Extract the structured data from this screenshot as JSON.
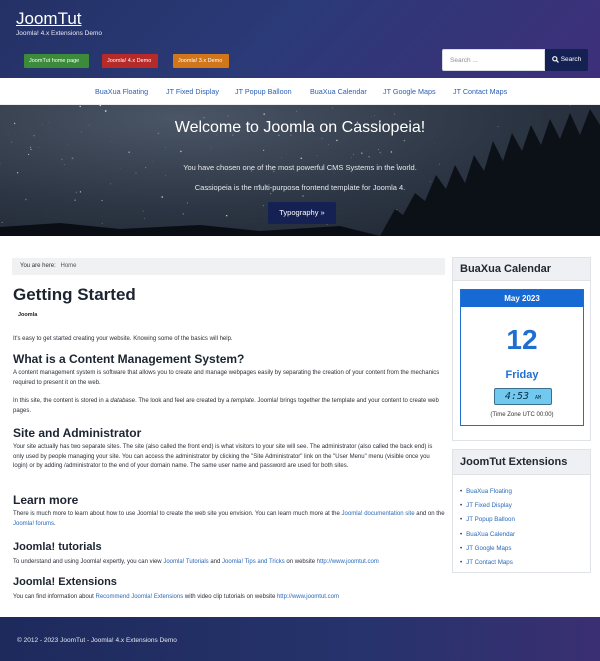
{
  "header": {
    "brand_title": "JoomTut",
    "brand_desc": "Joomla! 4.x Extensions Demo",
    "buttons": [
      "JoomTut home page",
      "Joomla! 4.x Demo",
      "Joomla! 3.x Demo"
    ],
    "search_placeholder": "Search ...",
    "search_button": "Search"
  },
  "nav": {
    "items": [
      "BuaXua Floating",
      "JT Fixed Display",
      "JT Popup Balloon",
      "BuaXua Calendar",
      "JT Google Maps",
      "JT Contact Maps"
    ]
  },
  "banner": {
    "title": "Welcome to Joomla on Cassiopeia!",
    "line1": "You have chosen one of the most powerful CMS Systems in the world.",
    "line2": "Cassiopeia is the multi-purpose frontend template for Joomla 4.",
    "button": "Typography »"
  },
  "breadcrumb": {
    "label": "You are here:",
    "current": "Home"
  },
  "article": {
    "title": "Getting Started",
    "category": "Joomla",
    "intro": "It's easy to get started creating your website. Knowing some of the basics will help.",
    "cms_heading": "What is a Content Management System?",
    "cms_p1": "A content management system is software that allows you to create and manage webpages easily by separating the creation of your content from the mechanics required to present it on the web.",
    "cms_p2_a": "In this site, the content is stored in a ",
    "cms_p2_b": "database",
    "cms_p2_c": ". The look and feel are created by a ",
    "cms_p2_d": "template",
    "cms_p2_e": ". Joomla! brings together the template and your content to create web pages.",
    "admin_heading": "Site and Administrator",
    "admin_p": "Your site actually has two separate sites. The site (also called the front end) is what visitors to your site will see. The administrator (also called the back end) is only used by people managing your site. You can access the administrator by clicking the \"Site Administrator\" link on the \"User Menu\" menu (visible once you login) or by adding /administrator to the end of your domain name. The same user name and password are used for both sites.",
    "learn_heading": "Learn more",
    "learn_a": "There is much more to learn about how to use Joomla! to create the web site you envision. You can learn much more at the ",
    "learn_link1": "Joomla! documentation site",
    "learn_b": " and on the ",
    "learn_link2": "Joomla! forums",
    "learn_c": ".",
    "tutorials_heading": "Joomla! tutorials",
    "tut_a": "To understand and using Joomla! expertly, you can view ",
    "tut_link1": "Joomla! Tutorials",
    "tut_b": " and ",
    "tut_link2": "Joomla! Tips and Tricks",
    "tut_c": " on website ",
    "tut_link3": "http://www.joomtut.com",
    "ext_heading": "Joomla! Extensions",
    "ext_a": "You can find information about ",
    "ext_link1": "Recommend Joomla! Extensions",
    "ext_b": " with video clip tutorials on website ",
    "ext_link2": "http://www.joomtut.com"
  },
  "calendar": {
    "heading": "BuaXua Calendar",
    "month": "May 2023",
    "day": "12",
    "weekday": "Friday",
    "time": "4:53",
    "ampm": "AM",
    "timezone": "(Time Zone UTC 00:00)"
  },
  "extensions": {
    "heading": "JoomTut Extensions",
    "items": [
      "BuaXua Floating",
      "JT Fixed Display",
      "JT Popup Balloon",
      "BuaXua Calendar",
      "JT Google Maps",
      "JT Contact Maps"
    ]
  },
  "footer": {
    "text": "© 2012 - 2023 JoomTut - Joomla! 4.x Extensions Demo"
  },
  "colors": {
    "header_bg": "#2b3a78",
    "nav_link": "#2a5fb4",
    "dark_button": "#142152",
    "calendar_blue": "#1769d3",
    "btn_home": "#3c8b3a",
    "btn_j4": "#b72a2a",
    "btn_j3": "#d1761b"
  },
  "icons": {
    "search": "search-icon",
    "stars": "stars-decoration",
    "trees": "tree-silhouette"
  }
}
